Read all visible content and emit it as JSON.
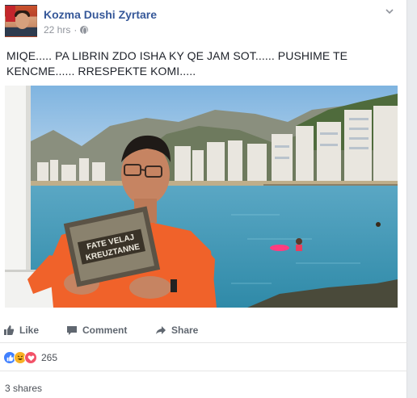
{
  "post": {
    "author": "Kozma Dushi Zyrtare",
    "time": "22 hrs",
    "separator": "·",
    "text": "MIQE..... PA LIBRIN ZDO ISHA KY QE JAM SOT...... PUSHIME TE KENCME...... RRESPEKTE KOMI.....",
    "book_title_line1": "FATE VELAJ",
    "book_title_line2": "KREUZTANNE"
  },
  "actions": {
    "like": "Like",
    "comment": "Comment",
    "share": "Share"
  },
  "reactions": {
    "count": "265",
    "types": [
      "like-icon",
      "haha-icon",
      "love-icon"
    ]
  },
  "shares": "3 shares",
  "colors": {
    "link_blue": "#365899",
    "meta_gray": "#90949c",
    "like_blue": "#4080ff",
    "haha_yellow": "#f7b125",
    "love_red": "#f25268",
    "shirt_orange": "#f0622a",
    "sea": "#4aa3c2"
  }
}
